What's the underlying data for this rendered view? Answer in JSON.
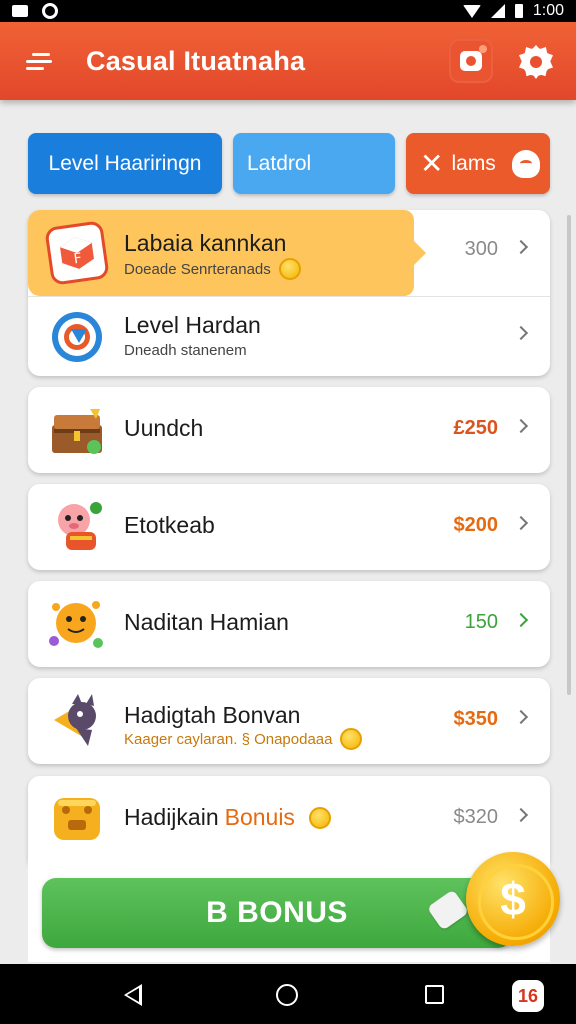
{
  "status_bar": {
    "time": "1:00"
  },
  "app_bar": {
    "title": "Casual Ituatnaha",
    "notification_dot": true
  },
  "tabs": [
    {
      "label": "Level Haariringn",
      "color": "#1a7fdc",
      "active": true
    },
    {
      "label": "Latdrol",
      "color": "#4aa8f0",
      "active": false
    },
    {
      "label": "lams",
      "color": "#eb5a2a",
      "active": false
    }
  ],
  "list": {
    "items": [
      {
        "title": "Labaia kannkan",
        "subtitle": "Doeade Senrteranads",
        "value": "300",
        "value_color": "#8a8a8a",
        "icon": "cube-icon",
        "highlighted": true,
        "subtitle_coin": true
      },
      {
        "title": "Level Hardan",
        "subtitle": "Dneadh stanenem",
        "value": "",
        "value_color": "#8a8a8a",
        "icon": "target-icon",
        "highlighted": false,
        "subtitle_coin": false
      },
      {
        "title": "Uundch",
        "subtitle": "",
        "value": "£250",
        "value_color": "#d9541e",
        "icon": "chest-icon",
        "highlighted": false,
        "subtitle_coin": false
      },
      {
        "title": "Etotkeab",
        "subtitle": "",
        "value": "$200",
        "value_color": "#e56a10",
        "icon": "pig-icon",
        "highlighted": false,
        "subtitle_coin": false
      },
      {
        "title": "Naditan Hamian",
        "subtitle": "",
        "value": "150",
        "value_color": "#3aa33a",
        "icon": "sun-creature-icon",
        "highlighted": false,
        "subtitle_coin": false
      },
      {
        "title": "Hadigtah Bonvan",
        "subtitle": "Kaager caylaran. § Onapodaaa",
        "value": "$350",
        "value_color": "#e56a10",
        "icon": "bird-icon",
        "highlighted": false,
        "subtitle_coin": true
      },
      {
        "title": "Hadijkain",
        "title_accent": "Bonuis",
        "subtitle": "",
        "value": "$320",
        "value_color": "#8a8a8a",
        "icon": "gold-cube-icon",
        "highlighted": false,
        "subtitle_coin": false
      }
    ]
  },
  "bonus": {
    "label": "B BONUS",
    "coin_symbol": "$"
  },
  "nav_bar": {
    "app_icon_label": "16"
  }
}
